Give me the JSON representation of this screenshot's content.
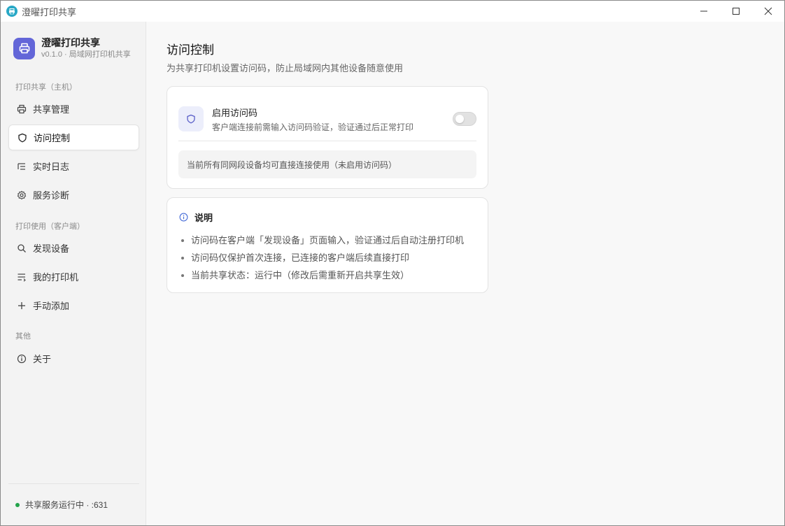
{
  "window": {
    "title": "澄曜打印共享"
  },
  "brand": {
    "name": "澄曜打印共享",
    "version": "v0.1.0 · 局域网打印机共享"
  },
  "sidebar": {
    "sections": [
      {
        "label": "打印共享（主机）"
      },
      {
        "label": "打印使用（客户端）"
      },
      {
        "label": "其他"
      }
    ],
    "items": [
      {
        "label": "共享管理",
        "icon": "printer-icon",
        "active": false
      },
      {
        "label": "访问控制",
        "icon": "shield-icon",
        "active": true
      },
      {
        "label": "实时日志",
        "icon": "list-icon",
        "active": false
      },
      {
        "label": "服务诊断",
        "icon": "gear-icon",
        "active": false
      },
      {
        "label": "发现设备",
        "icon": "search-icon",
        "active": false
      },
      {
        "label": "我的打印机",
        "icon": "list-plus-icon",
        "active": false
      },
      {
        "label": "手动添加",
        "icon": "plus-icon",
        "active": false
      },
      {
        "label": "关于",
        "icon": "info-icon",
        "active": false
      }
    ],
    "status": "共享服务运行中 · :631"
  },
  "main": {
    "title": "访问控制",
    "subtitle": "为共享打印机设置访问码，防止局域网内其他设备随意使用",
    "access_code": {
      "title": "启用访问码",
      "description": "客户端连接前需输入访问码验证，验证通过后正常打印",
      "enabled": false,
      "notice": "当前所有同网段设备均可直接连接使用（未启用访问码）"
    },
    "info": {
      "title": "说明",
      "items": [
        "访问码在客户端「发现设备」页面输入，验证通过后自动注册打印机",
        "访问码仅保护首次连接，已连接的客户端后续直接打印",
        "当前共享状态：运行中（修改后需重新开启共享生效）"
      ]
    }
  },
  "colors": {
    "accent": "#6366d8",
    "status_ok": "#22a34a",
    "app_icon": "#28a8c6"
  }
}
